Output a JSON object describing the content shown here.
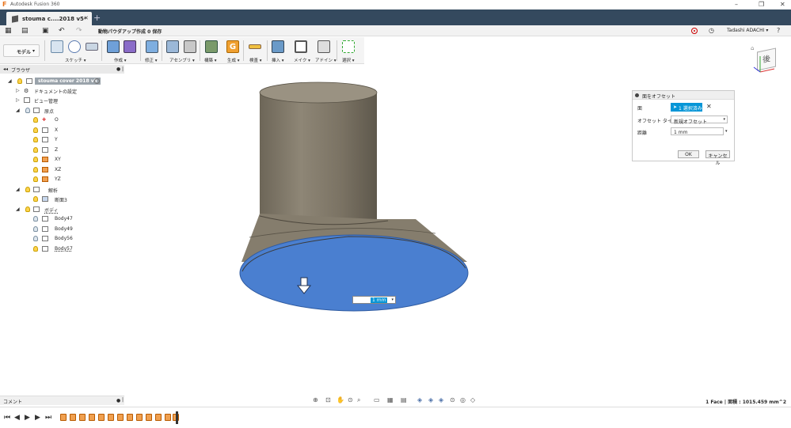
{
  "window": {
    "title": "Autodesk Fusion 360"
  },
  "tab": {
    "name": "stouma c....2018 v5*"
  },
  "quick_access": {
    "save_title": "動物パウダアップ作成 0 保存"
  },
  "user": {
    "name": "Tadashi ADACHI ▾"
  },
  "workspace": {
    "label": "モデル"
  },
  "toolbar": {
    "groups": [
      {
        "label": "スケッチ ▾"
      },
      {
        "label": "作成 ▾"
      },
      {
        "label": "修正 ▾"
      },
      {
        "label": "アセンブリ ▾"
      },
      {
        "label": "構築 ▾"
      },
      {
        "label": "生成 ▾"
      },
      {
        "label": "検査 ▾"
      },
      {
        "label": "挿入 ▾"
      },
      {
        "label": "メイク ▾"
      },
      {
        "label": "アドイン ▾"
      },
      {
        "label": "選択 ▾"
      }
    ]
  },
  "browser": {
    "title": "ブラウザ",
    "root": "stouma cover 2018 v5",
    "items": [
      {
        "label": "ドキュメントの設定"
      },
      {
        "label": "ビュー管理"
      },
      {
        "label": "原点"
      },
      {
        "label": "O"
      },
      {
        "label": "X"
      },
      {
        "label": "Y"
      },
      {
        "label": "Z"
      },
      {
        "label": "XY"
      },
      {
        "label": "XZ"
      },
      {
        "label": "YZ"
      },
      {
        "label": "解析"
      },
      {
        "label": "断面3"
      },
      {
        "label": "ボディ"
      },
      {
        "label": "Body47"
      },
      {
        "label": "Body49"
      },
      {
        "label": "Body56"
      },
      {
        "label": "Body57"
      }
    ]
  },
  "viewcube": {
    "face_label": "後"
  },
  "offset_panel": {
    "title": "面をオフセット",
    "face_label": "面",
    "face_value": "1 選択済み",
    "type_label": "オフセット タイプ",
    "type_value": "新規オフセット",
    "distance_label": "距離",
    "distance_value": "1 mm",
    "ok_label": "OK",
    "cancel_label": "キャンセル"
  },
  "canvas": {
    "input_value": "1 mm"
  },
  "comment": {
    "label": "コメント"
  },
  "status": {
    "text": "1 Face | 面積 : 1015.459 mm^2"
  },
  "colors": {
    "selected_face": "#4a7fd0",
    "body": "#8a8272",
    "accent": "#0696d7"
  }
}
